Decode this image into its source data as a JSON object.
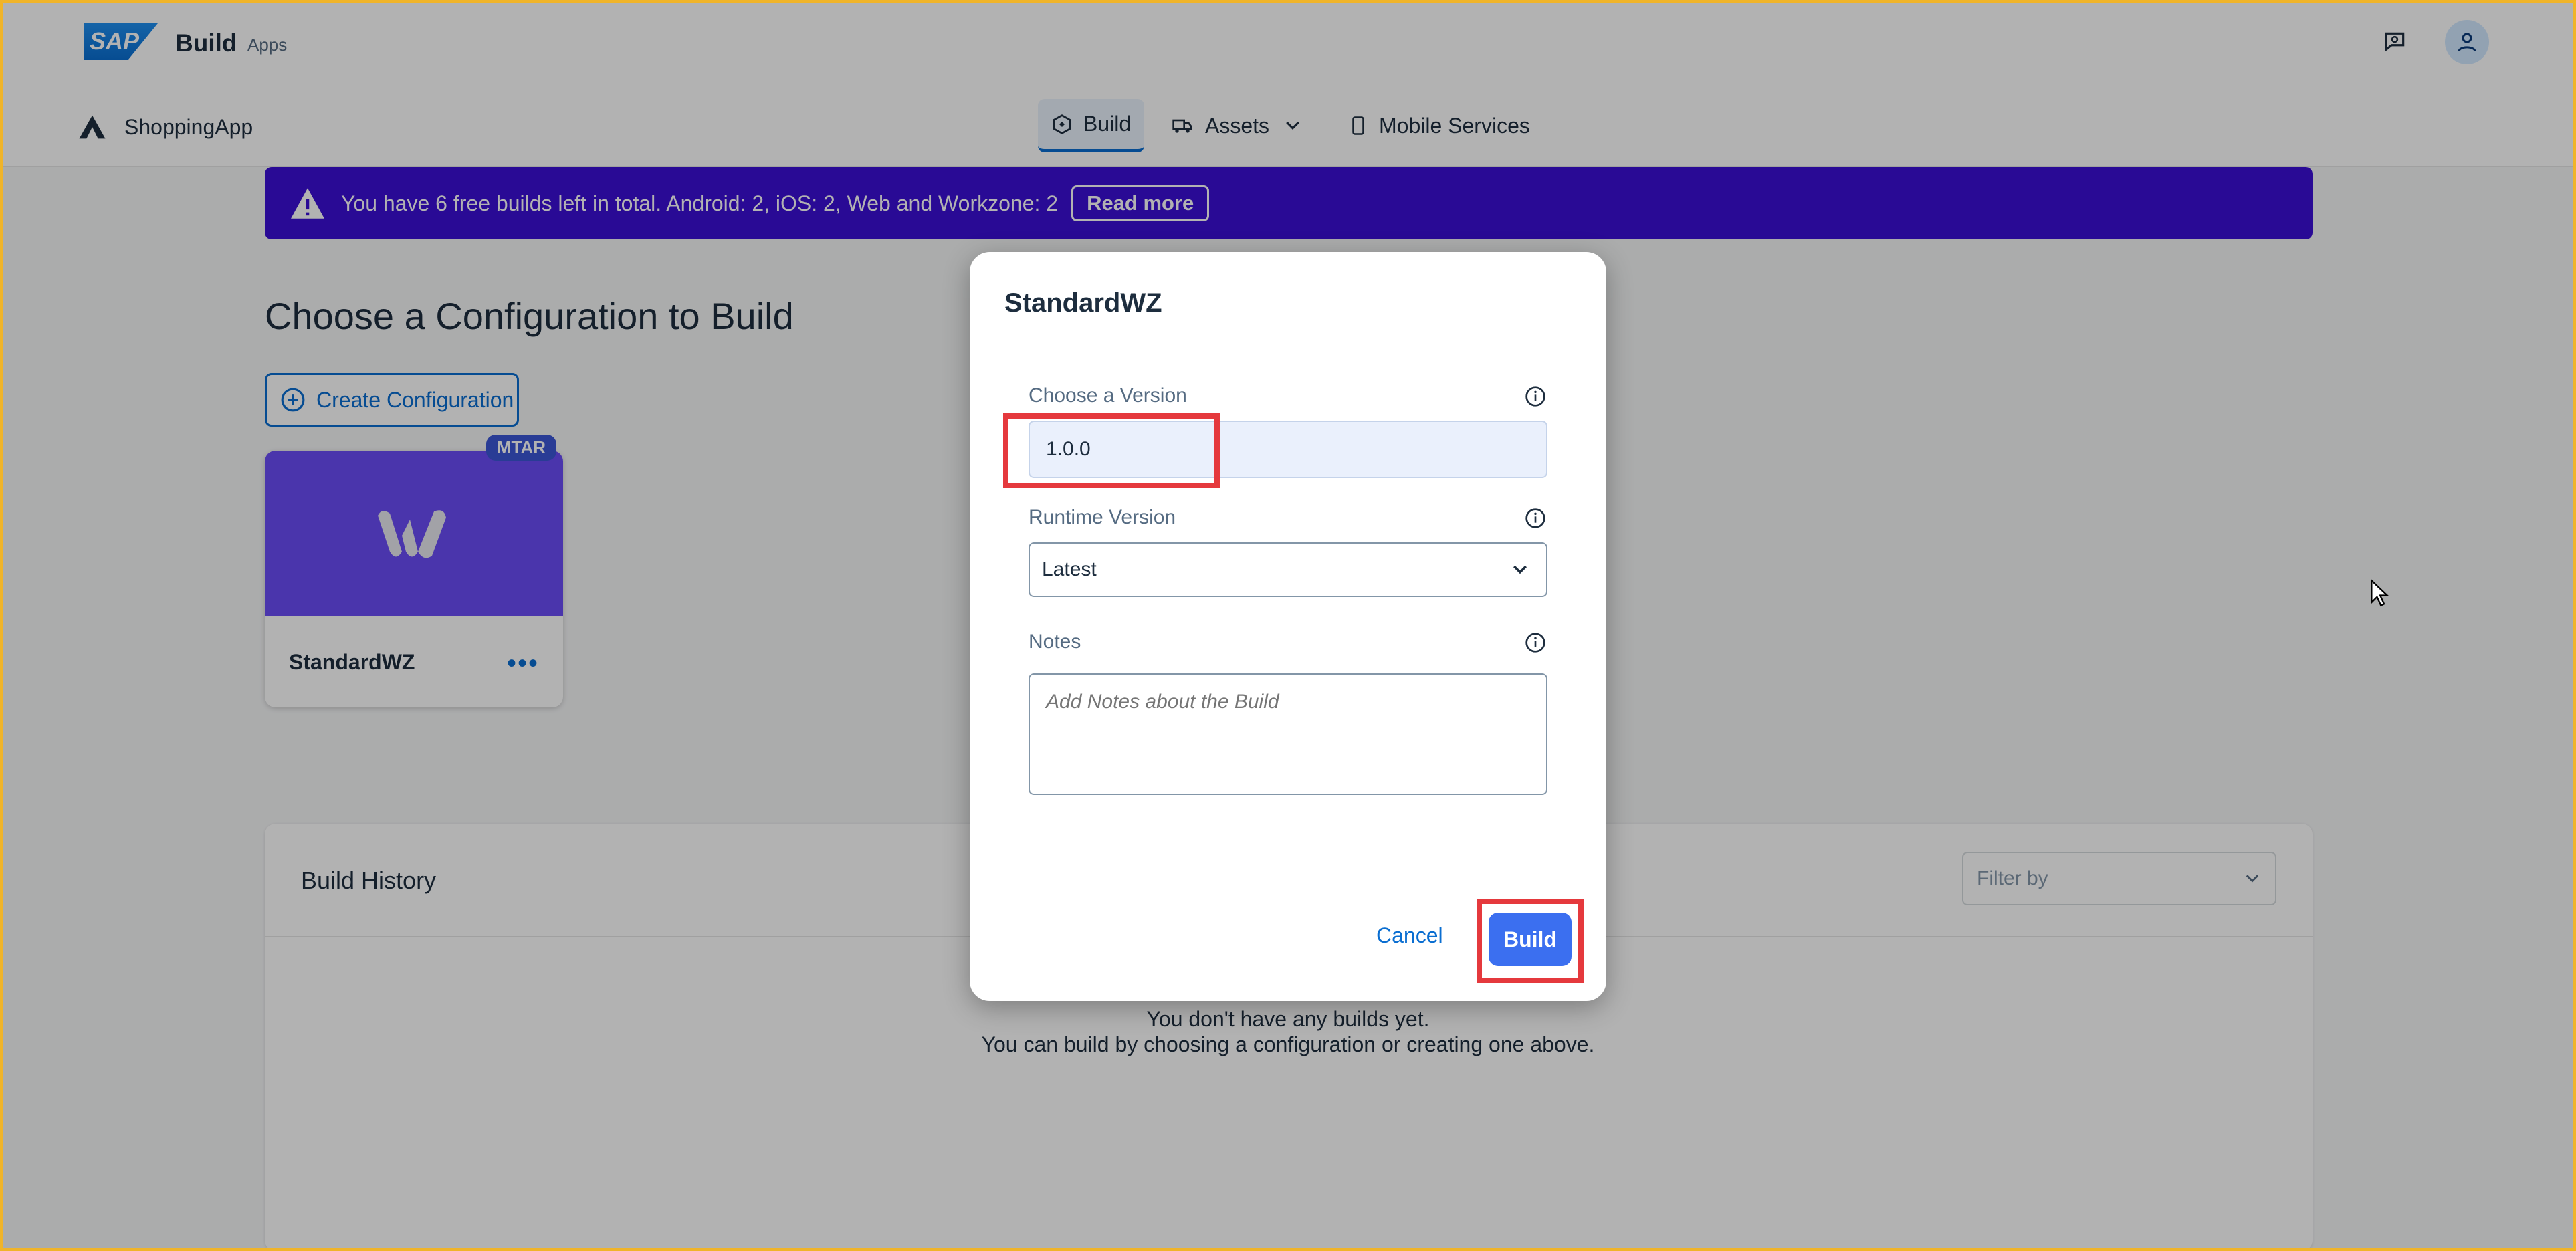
{
  "shell": {
    "logo_text": "SAP",
    "title": "Build",
    "subtitle": "Apps"
  },
  "project": {
    "name": "ShoppingApp"
  },
  "tabs": [
    {
      "label": "Build",
      "active": true
    },
    {
      "label": "Assets"
    },
    {
      "label": "Mobile Services"
    }
  ],
  "banner": {
    "text": "You have 6 free builds left in total. Android: 2, iOS: 2, Web and Workzone: 2",
    "link": "Read more"
  },
  "page": {
    "title": "Choose a Configuration to Build",
    "create_label": "Create Configuration"
  },
  "config_card": {
    "badge": "MTAR",
    "name": "StandardWZ",
    "more": "•••"
  },
  "history": {
    "title": "Build History",
    "filter_placeholder": "Filter by",
    "empty_line1": "You don't have any builds yet.",
    "empty_line2": "You can build by choosing a configuration or creating one above."
  },
  "dialog": {
    "title": "StandardWZ",
    "version_label": "Choose a Version",
    "version_value": "1.0.0",
    "runtime_label": "Runtime Version",
    "runtime_value": "Latest",
    "notes_label": "Notes",
    "notes_placeholder": "Add Notes about the Build",
    "cancel_label": "Cancel",
    "build_label": "Build"
  },
  "colors": {
    "brand_blue": "#0a6ed1",
    "banner_purple": "#3c0fd6",
    "card_purple": "#6b4cf6",
    "build_button": "#3b6ff0",
    "highlight_red": "#e5393d"
  }
}
